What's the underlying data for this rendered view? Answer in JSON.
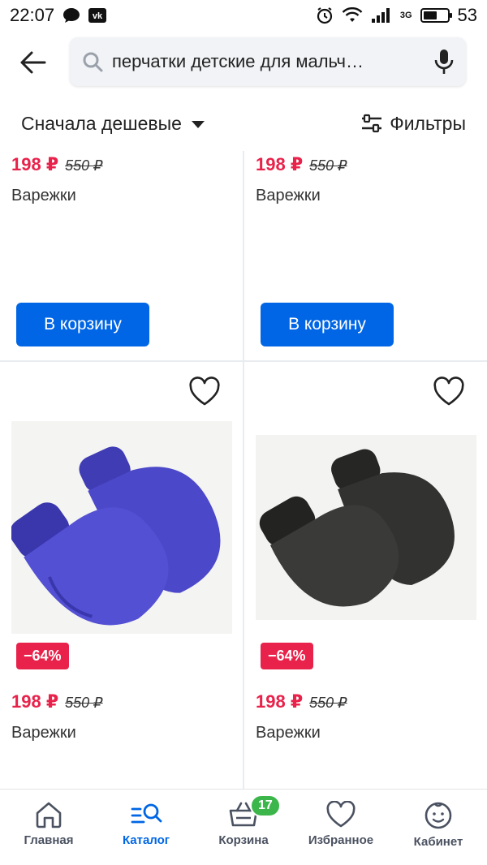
{
  "status_bar": {
    "time": "22:07",
    "network": "3G",
    "battery": "53"
  },
  "search": {
    "query": "перчатки детские для мальч…"
  },
  "sort": {
    "label": "Сначала дешевые"
  },
  "filters": {
    "label": "Фильтры"
  },
  "products": [
    {
      "price": "198 ₽",
      "old_price": "550 ₽",
      "title": "Варежки",
      "button": "В корзину"
    },
    {
      "price": "198 ₽",
      "old_price": "550 ₽",
      "title": "Варежки",
      "button": "В корзину"
    },
    {
      "price": "198 ₽",
      "old_price": "550 ₽",
      "title": "Варежки",
      "discount": "−64%",
      "image": "blue-mittens"
    },
    {
      "price": "198 ₽",
      "old_price": "550 ₽",
      "title": "Варежки",
      "discount": "−64%",
      "image": "black-mittens"
    }
  ],
  "nav": {
    "items": [
      {
        "label": "Главная",
        "icon": "home-icon"
      },
      {
        "label": "Каталог",
        "icon": "catalog-search-icon",
        "active": true
      },
      {
        "label": "Корзина",
        "icon": "basket-icon",
        "badge": "17"
      },
      {
        "label": "Избранное",
        "icon": "heart-icon"
      },
      {
        "label": "Кабинет",
        "icon": "face-icon"
      }
    ]
  },
  "colors": {
    "accent": "#0066e5",
    "price": "#e8224a",
    "discount_bg": "#e8224a",
    "badge": "#3cb64a"
  }
}
